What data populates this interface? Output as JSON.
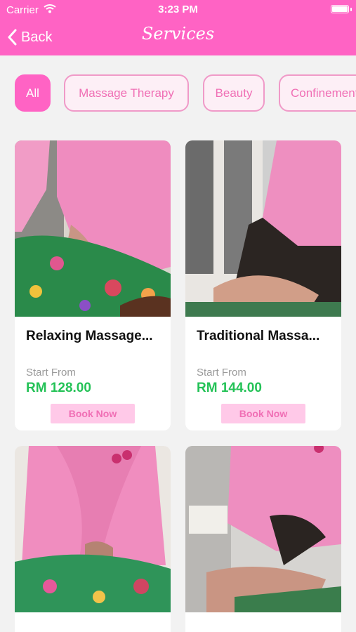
{
  "status_bar": {
    "carrier": "Carrier",
    "time": "3:23 PM"
  },
  "header": {
    "back_label": "Back",
    "title": "Services"
  },
  "colors": {
    "brand": "#ff63c4",
    "price": "#24c257",
    "book_bg": "#ffc9e8",
    "chip_text": "#f06fb5"
  },
  "categories": [
    "All",
    "Massage Therapy",
    "Beauty",
    "Confinement"
  ],
  "services": [
    {
      "title": "Relaxing Massage...",
      "from_label": "Start From",
      "price": "RM 128.00",
      "cta": "Book Now"
    },
    {
      "title": "Traditional Massa...",
      "from_label": "Start From",
      "price": "RM 144.00",
      "cta": "Book Now"
    },
    {
      "title": "",
      "from_label": "",
      "price": "",
      "cta": ""
    },
    {
      "title": "",
      "from_label": "",
      "price": "",
      "cta": ""
    }
  ]
}
